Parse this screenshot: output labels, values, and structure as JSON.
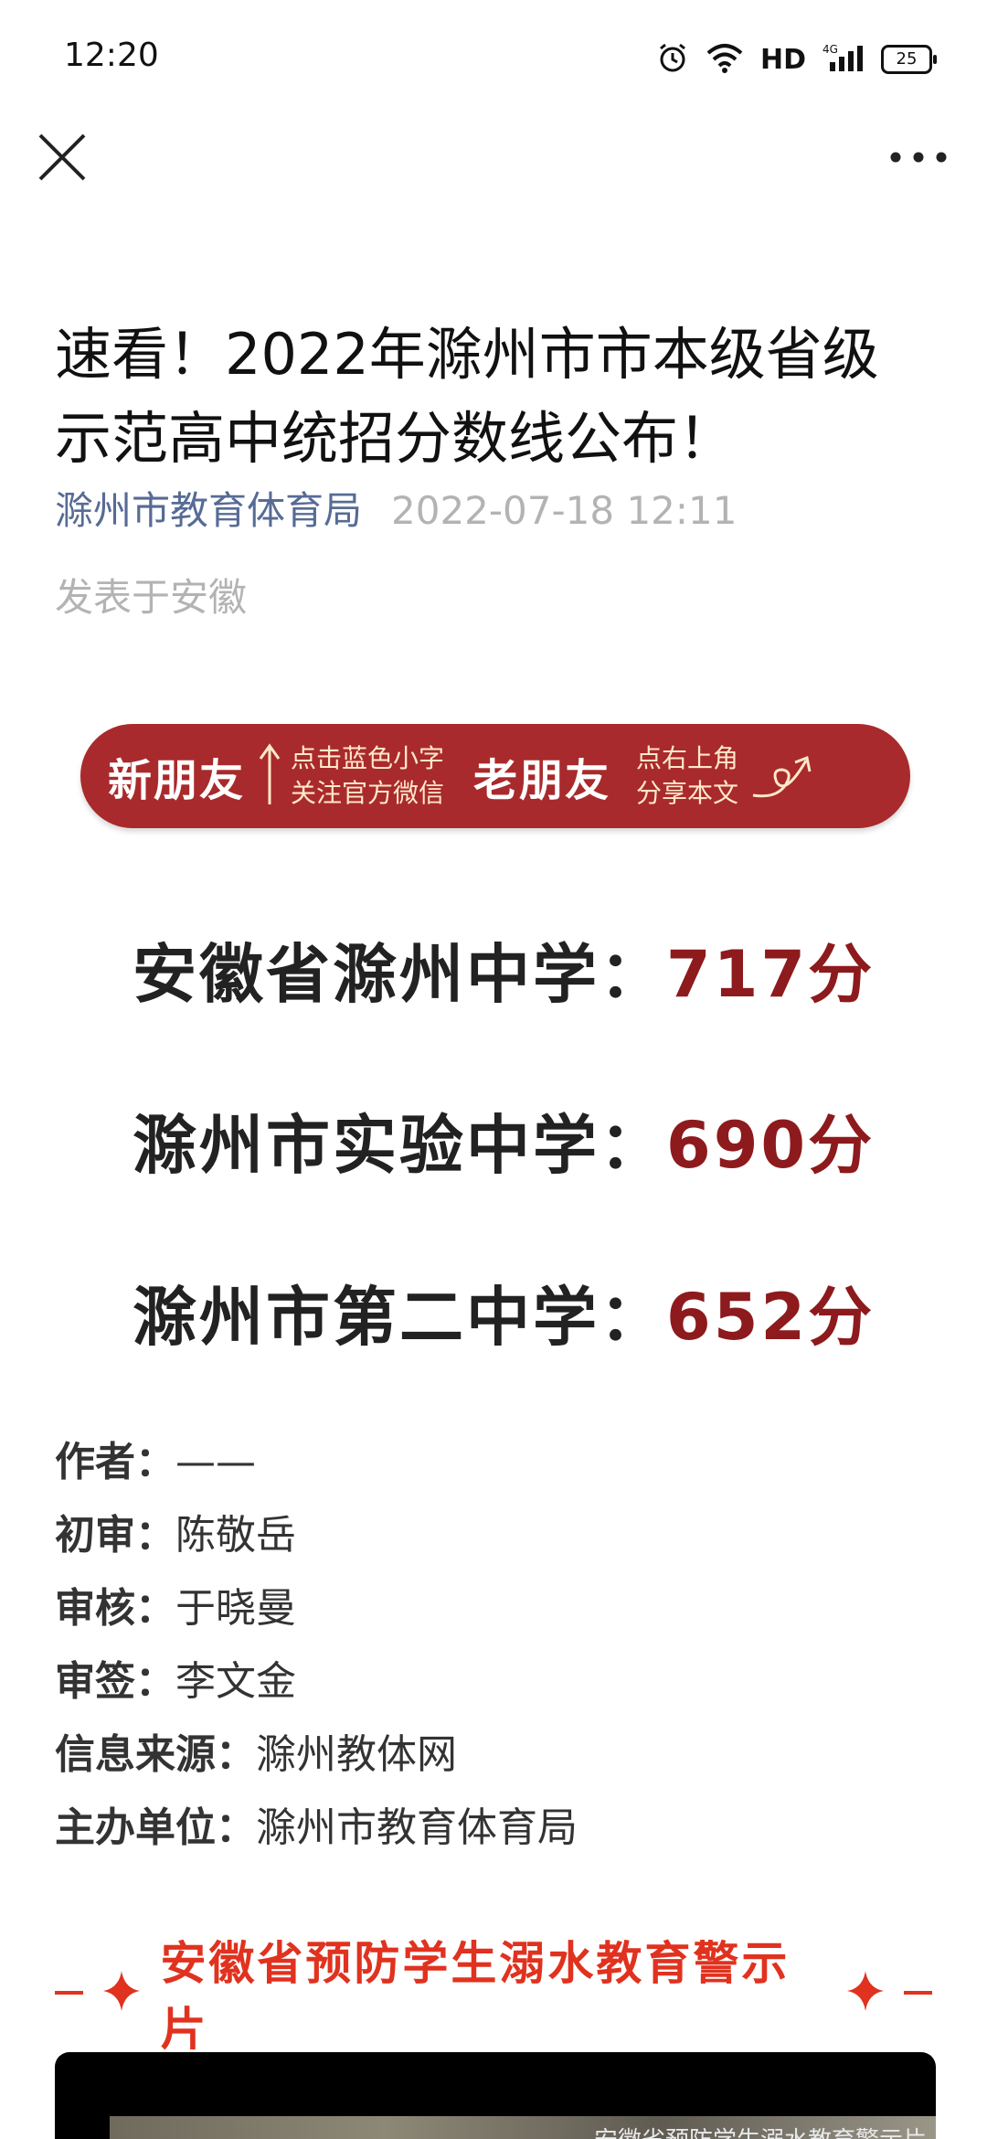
{
  "status_bar": {
    "time": "12:20",
    "network": "HD",
    "signal": "4G",
    "battery": "25"
  },
  "nav": {
    "close_icon": "close-icon",
    "more_icon": "more-icon"
  },
  "article": {
    "title": "速看！2022年滁州市市本级省级示范高中统招分数线公布！",
    "account": "滁州市教育体育局",
    "date": "2022-07-18 12:11",
    "location": "发表于安徽"
  },
  "banner": {
    "new_friend": "新朋友",
    "new_hint_1": "点击蓝色小字",
    "new_hint_2": "关注官方微信",
    "old_friend": "老朋友",
    "old_hint_1": "点右上角",
    "old_hint_2": "分享本文",
    "color": "#a92a2c"
  },
  "scores": [
    {
      "school": "安徽省滁州中学：",
      "score": "717分"
    },
    {
      "school": "滁州市实验中学：",
      "score": "690分"
    },
    {
      "school": "滁州市第二中学：",
      "score": "652分"
    }
  ],
  "credits": [
    {
      "label": "作者：",
      "value": "——"
    },
    {
      "label": "初审：",
      "value": "陈敬岳"
    },
    {
      "label": "审核：",
      "value": "于晓曼"
    },
    {
      "label": "审签：",
      "value": "李文金"
    },
    {
      "label": "信息来源：",
      "value": "滁州教体网"
    },
    {
      "label": "主办单位：",
      "value": "滁州市教育体育局"
    }
  ],
  "section": {
    "heading": "安徽省预防学生溺水教育警示片",
    "accent": "#e0321f"
  },
  "video": {
    "caption": "安徽省预防学生溺水教育警示片"
  }
}
